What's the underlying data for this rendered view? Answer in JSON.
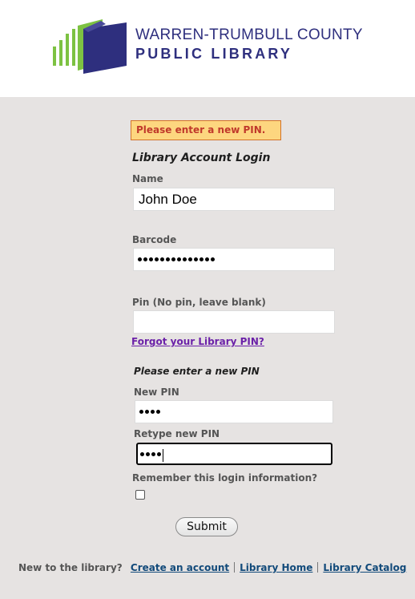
{
  "header": {
    "logo_line1": "WARREN-TRUMBULL COUNTY",
    "logo_line2": "PUBLIC LIBRARY"
  },
  "alert": {
    "text": "Please enter a new PIN."
  },
  "form": {
    "title": "Library Account Login",
    "name_label": "Name",
    "name_value": "John Doe",
    "barcode_label": "Barcode",
    "barcode_masked_length": 14,
    "pin_label": "Pin (No pin, leave blank)",
    "pin_value": "",
    "forgot_link": "Forgot your Library PIN?",
    "new_pin_heading": "Please enter a new PIN",
    "new_pin_label": "New PIN",
    "new_pin_masked_length": 4,
    "retype_label": "Retype new PIN",
    "retype_masked_length": 4,
    "remember_label": "Remember this login information?",
    "remember_checked": false,
    "submit_label": "Submit"
  },
  "footer": {
    "prompt": "New to the library?",
    "create_account": "Create an account",
    "library_home": "Library Home",
    "library_catalog": "Library Catalog"
  },
  "colors": {
    "brand": "#2e2f7e",
    "logo_green": "#7dc242",
    "alert_bg": "#fdd67f",
    "alert_text": "#c0392b",
    "link_visited": "#6b21a8",
    "link": "#124a7a"
  }
}
